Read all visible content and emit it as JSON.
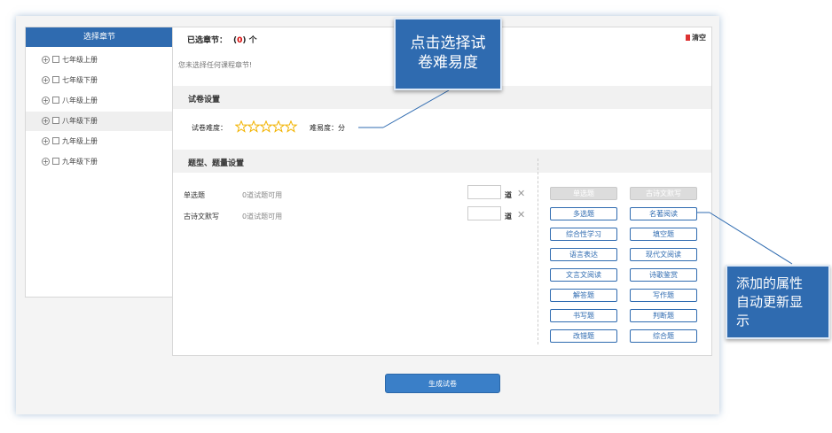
{
  "sidebar": {
    "header": "选择章节",
    "items": [
      {
        "label": "七年级上册"
      },
      {
        "label": "七年级下册"
      },
      {
        "label": "八年级上册"
      },
      {
        "label": "八年级下册"
      },
      {
        "label": "九年级上册"
      },
      {
        "label": "九年级下册"
      }
    ]
  },
  "selection": {
    "label": "已选章节：",
    "count_open": "(",
    "count_value": "0",
    "count_close": ")",
    "count_unit": "个",
    "clear_label": "清空",
    "empty_tip": "您未选择任何课程章节!"
  },
  "paper_settings": {
    "title": "试卷设置",
    "difficulty_label": "试卷难度：",
    "rating": 0,
    "rating_max": 5,
    "difficulty_score_label": "难易度：分"
  },
  "type_settings": {
    "title": "题型、题量设置",
    "rows": [
      {
        "name": "单选题",
        "available": "0道试题可用",
        "unit": "道",
        "remove": "✕"
      },
      {
        "name": "古诗文默写",
        "available": "0道试题可用",
        "unit": "道",
        "remove": "✕"
      }
    ],
    "types": [
      {
        "label": "单选题",
        "disabled": true
      },
      {
        "label": "古诗文默写",
        "disabled": true
      },
      {
        "label": "多选题",
        "disabled": false
      },
      {
        "label": "名著阅读",
        "disabled": false
      },
      {
        "label": "综合性学习",
        "disabled": false
      },
      {
        "label": "填空题",
        "disabled": false
      },
      {
        "label": "语言表达",
        "disabled": false
      },
      {
        "label": "现代文阅读",
        "disabled": false
      },
      {
        "label": "文言文阅读",
        "disabled": false
      },
      {
        "label": "诗歌鉴赏",
        "disabled": false
      },
      {
        "label": "解答题",
        "disabled": false
      },
      {
        "label": "写作题",
        "disabled": false
      },
      {
        "label": "书写题",
        "disabled": false
      },
      {
        "label": "判断题",
        "disabled": false
      },
      {
        "label": "改错题",
        "disabled": false
      },
      {
        "label": "综合题",
        "disabled": false
      }
    ]
  },
  "generate_button": "生成试卷",
  "callouts": {
    "difficulty_line1": "点击选择试",
    "difficulty_line2": "卷难易度",
    "attribute_line1": "添加的属性",
    "attribute_line2": "自动更新显",
    "attribute_line3": "示"
  },
  "colors": {
    "primary": "#2f6bb0",
    "star": "#f2b300",
    "count_red": "#d60000"
  }
}
